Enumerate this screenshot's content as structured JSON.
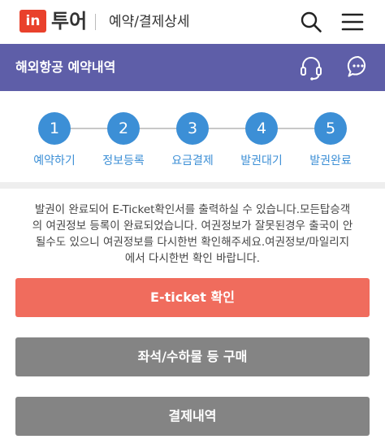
{
  "topbar": {
    "logo_mark": "in",
    "logo_text": "투어",
    "page_title": "예약/결제상세",
    "icons": [
      "search-icon",
      "menu-icon"
    ]
  },
  "header": {
    "title": "해외항공 예약내역",
    "background": "#5e5ea8",
    "icons": [
      "headset-icon",
      "chat-icon"
    ]
  },
  "steps": {
    "accent": "#3c8fd6",
    "items": [
      {
        "number": "1",
        "label": "예약하기"
      },
      {
        "number": "2",
        "label": "정보등록"
      },
      {
        "number": "3",
        "label": "요금결제"
      },
      {
        "number": "4",
        "label": "발권대기"
      },
      {
        "number": "5",
        "label": "발권완료"
      }
    ]
  },
  "notice": {
    "lines": [
      "발권이 완료되어 E-Ticket확인서를 출력하실 수 있습니다.모든탑승객",
      "의 여권정보 등록이 완료되었습니다. 여권정보가 잘못된경우 출국이 안",
      "될수도 있으니 여권정보를 다시한번 확인해주세요.여권정보/마일리지",
      "에서 다시한번 확인 바랍니다."
    ]
  },
  "buttons": {
    "eticket": "E-ticket 확인",
    "seat": "좌석/수하물 등 구매",
    "payment": "결제내역",
    "eticket_color": "#f06c5d",
    "secondary_color": "#848484"
  }
}
